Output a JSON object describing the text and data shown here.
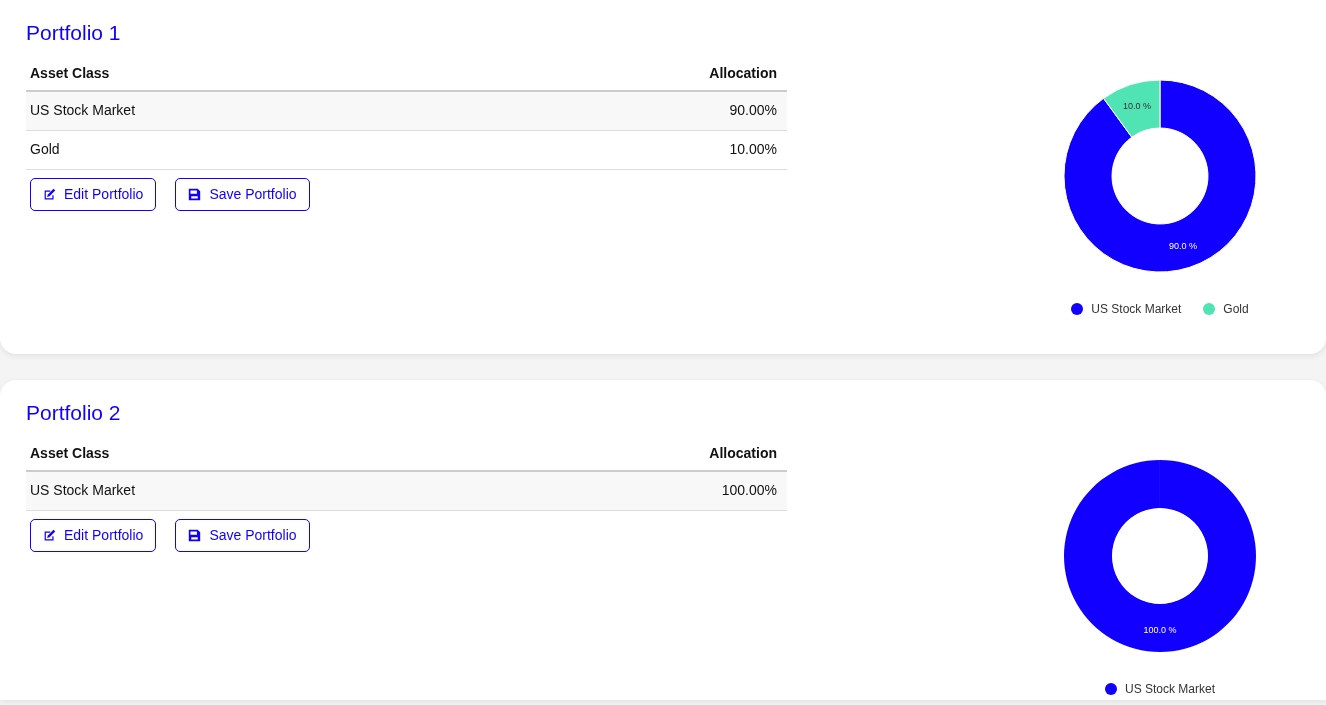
{
  "portfolios": [
    {
      "title": "Portfolio 1",
      "table": {
        "columns": [
          "Asset Class",
          "Allocation"
        ],
        "rows": [
          [
            "US Stock Market",
            "90.00%"
          ],
          [
            "Gold",
            "10.00%"
          ]
        ]
      },
      "buttons": [
        {
          "kind": "edit",
          "label": "Edit Portfolio"
        },
        {
          "kind": "save",
          "label": "Save Portfolio"
        }
      ],
      "chart_data": {
        "type": "donut",
        "categories": [
          "US Stock Market",
          "Gold"
        ],
        "values": [
          90,
          10
        ],
        "colors": [
          "#1100ff",
          "#50e3b4"
        ],
        "value_labels": [
          "90.0 %",
          "10.0 %"
        ]
      }
    },
    {
      "title": "Portfolio 2",
      "table": {
        "columns": [
          "Asset Class",
          "Allocation"
        ],
        "rows": [
          [
            "US Stock Market",
            "100.00%"
          ]
        ]
      },
      "buttons": [
        {
          "kind": "edit",
          "label": "Edit Portfolio"
        },
        {
          "kind": "save",
          "label": "Save Portfolio"
        }
      ],
      "chart_data": {
        "type": "donut",
        "categories": [
          "US Stock Market"
        ],
        "values": [
          100
        ],
        "colors": [
          "#1100ff"
        ],
        "value_labels": [
          "100.0 %"
        ]
      }
    }
  ]
}
